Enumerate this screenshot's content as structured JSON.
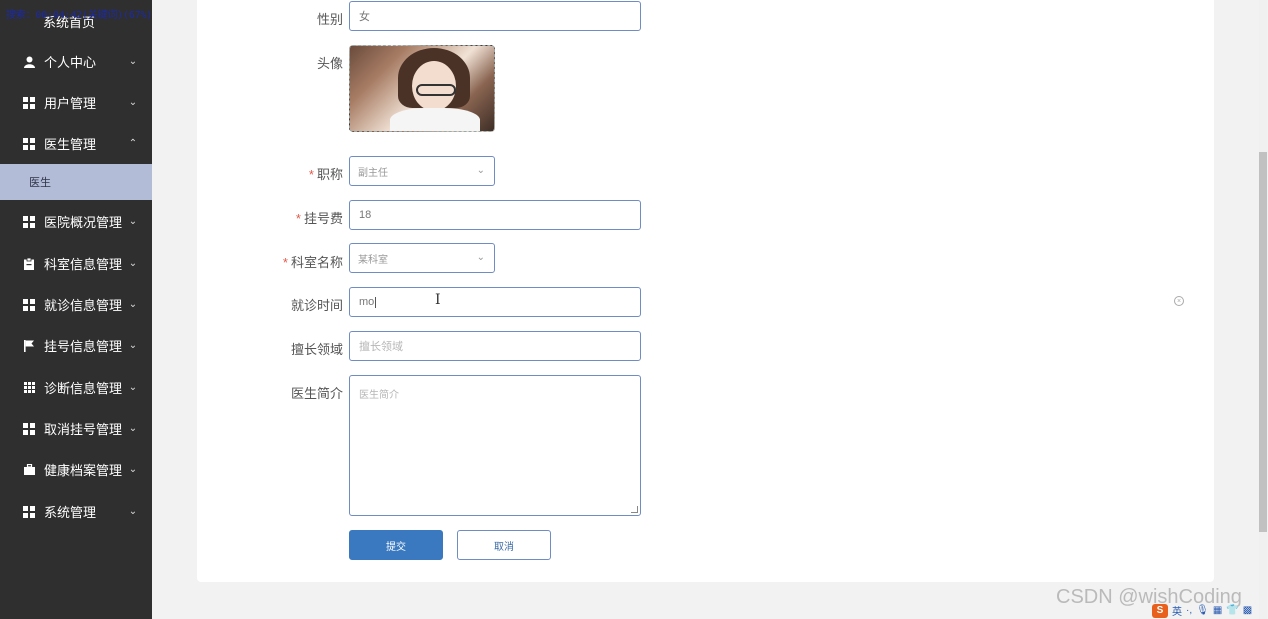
{
  "overlay": {
    "status_text": "搜索：00:04:42(关键词)(67%)"
  },
  "sidebar": {
    "top_partial_label": "系统首页",
    "items": [
      {
        "label": "个人中心",
        "icon": "user-icon",
        "chevron": "⌄"
      },
      {
        "label": "用户管理",
        "icon": "grid-icon",
        "chevron": "⌄"
      },
      {
        "label": "医生管理",
        "icon": "grid-icon",
        "chevron": "⌃"
      },
      {
        "label": "医院概况管理",
        "icon": "grid-icon",
        "chevron": "⌄"
      },
      {
        "label": "科室信息管理",
        "icon": "clipboard-icon",
        "chevron": "⌄"
      },
      {
        "label": "就诊信息管理",
        "icon": "grid-icon",
        "chevron": "⌄"
      },
      {
        "label": "挂号信息管理",
        "icon": "flag-icon",
        "chevron": "⌄"
      },
      {
        "label": "诊断信息管理",
        "icon": "grid9-icon",
        "chevron": "⌄"
      },
      {
        "label": "取消挂号管理",
        "icon": "grid-icon",
        "chevron": "⌄"
      },
      {
        "label": "健康档案管理",
        "icon": "briefcase-icon",
        "chevron": "⌄"
      },
      {
        "label": "系统管理",
        "icon": "grid-icon",
        "chevron": "⌄"
      }
    ],
    "sub_item": {
      "label": "医生"
    }
  },
  "form": {
    "gender": {
      "label": "性别",
      "value": "女"
    },
    "avatar": {
      "label": "头像"
    },
    "title": {
      "label": "职称",
      "value": "副主任"
    },
    "fee": {
      "label": "挂号费",
      "value": "18"
    },
    "department": {
      "label": "科室名称",
      "value": "某科室"
    },
    "visit_time": {
      "label": "就诊时间",
      "value": "mo"
    },
    "specialty": {
      "label": "擅长领域",
      "placeholder": "擅长领域"
    },
    "intro": {
      "label": "医生简介",
      "placeholder": "医生简介"
    },
    "submit_label": "提交",
    "cancel_label": "取消"
  },
  "watermark": "CSDN @wishCoding",
  "ime": {
    "logo": "S",
    "mode": "英"
  }
}
